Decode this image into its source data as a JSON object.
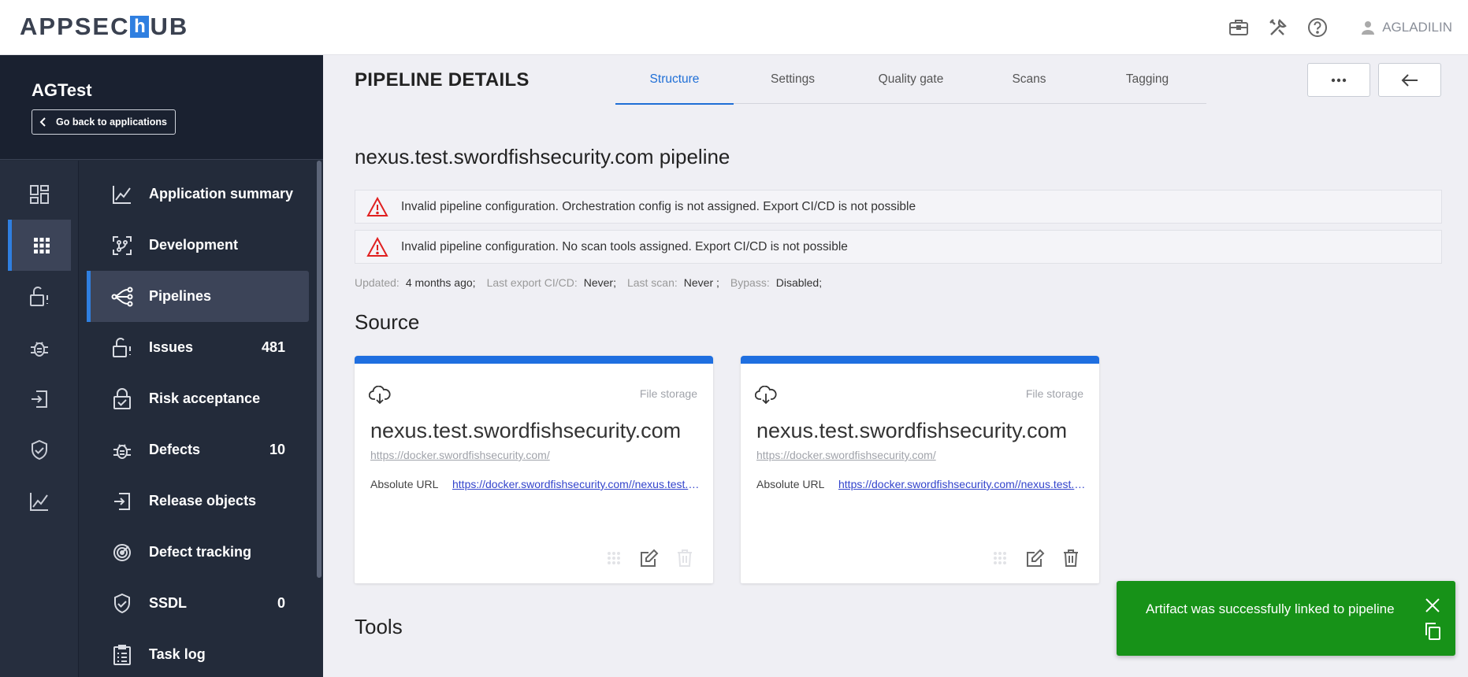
{
  "brand": {
    "logo_prefix": "APPSEC",
    "logo_mark": "h",
    "logo_suffix": "UB"
  },
  "topbar": {
    "username": "AGLADILIN"
  },
  "sidebar": {
    "app_title": "AGTest",
    "back_label": "Go back to applications",
    "items": [
      {
        "label": "Application summary",
        "count": ""
      },
      {
        "label": "Development",
        "count": ""
      },
      {
        "label": "Pipelines",
        "count": ""
      },
      {
        "label": "Issues",
        "count": "481"
      },
      {
        "label": "Risk acceptance",
        "count": ""
      },
      {
        "label": "Defects",
        "count": "10"
      },
      {
        "label": "Release objects",
        "count": ""
      },
      {
        "label": "Defect tracking",
        "count": ""
      },
      {
        "label": "SSDL",
        "count": "0"
      },
      {
        "label": "Task log",
        "count": ""
      }
    ]
  },
  "header": {
    "title": "PIPELINE DETAILS",
    "tabs": [
      {
        "label": "Structure",
        "active": true
      },
      {
        "label": "Settings"
      },
      {
        "label": "Quality gate"
      },
      {
        "label": "Scans"
      },
      {
        "label": "Tagging"
      }
    ]
  },
  "content": {
    "pipeline_name": "nexus.test.swordfishsecurity.com pipeline",
    "alerts": [
      "Invalid pipeline configuration. Orchestration config is not assigned. Export CI/CD is not possible",
      "Invalid pipeline configuration. No scan tools assigned. Export CI/CD is not possible"
    ],
    "meta": {
      "updated_label": "Updated:",
      "updated_value": "4 months ago;",
      "export_label": "Last export CI/CD:",
      "export_value": "Never;",
      "scan_label": "Last scan:",
      "scan_value": "Never ;",
      "bypass_label": "Bypass:",
      "bypass_value": "Disabled;"
    },
    "source_title": "Source",
    "tools_title": "Tools",
    "cards": [
      {
        "type": "File storage",
        "name": "nexus.test.swordfishsecurity.com",
        "url": "https://docker.swordfishsecurity.com/",
        "abs_label": "Absolute URL",
        "abs_url": "https://docker.swordfishsecurity.com//nexus.test.swordfishsecurity.com"
      },
      {
        "type": "File storage",
        "name": "nexus.test.swordfishsecurity.com",
        "url": "https://docker.swordfishsecurity.com/",
        "abs_label": "Absolute URL",
        "abs_url": "https://docker.swordfishsecurity.com//nexus.test.swordfishsecurity.com"
      }
    ]
  },
  "toast": {
    "message": "Artifact was successfully linked to pipeline"
  },
  "colors": {
    "accent": "#1f6fe0",
    "sidebar": "#232b3a",
    "toast": "#179218",
    "warning": "#e02020"
  }
}
